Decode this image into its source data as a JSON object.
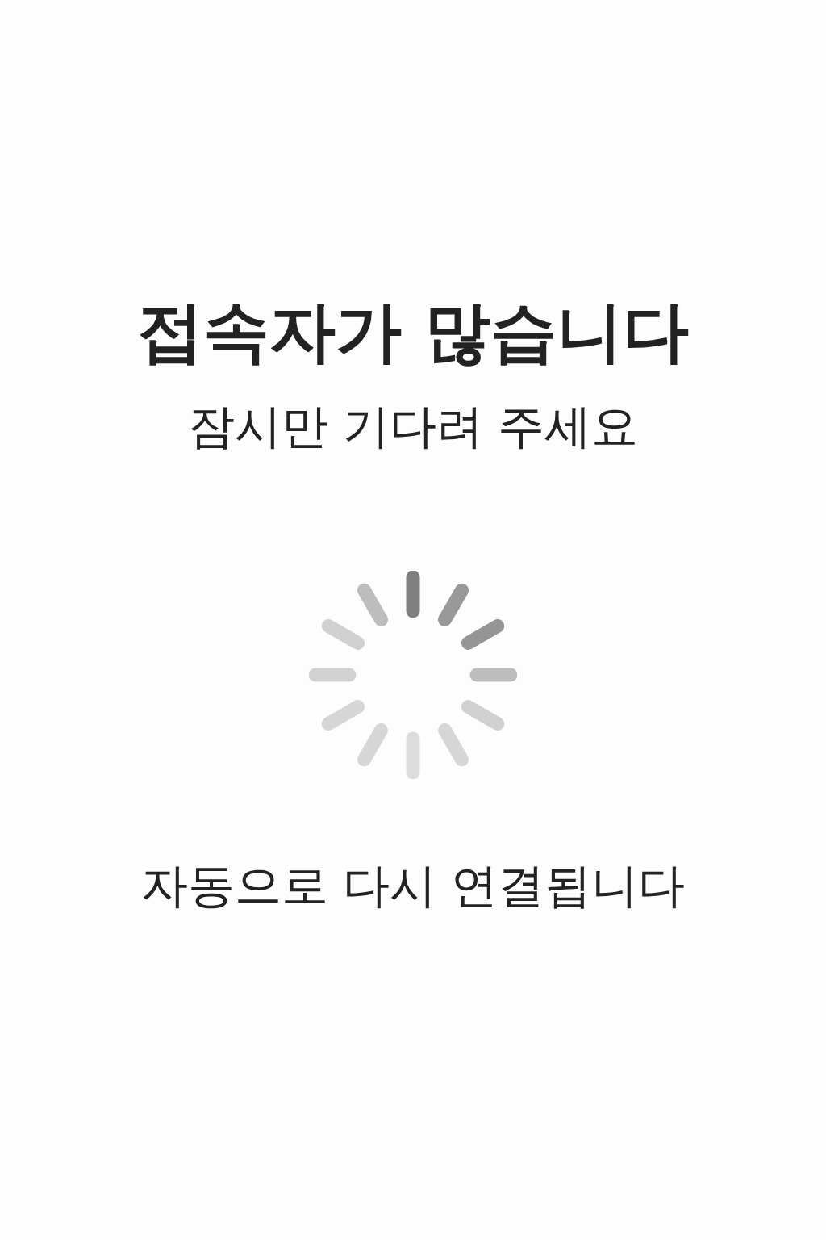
{
  "title": "접속자가 많습니다",
  "subtitle": "잠시만 기다려 주세요",
  "message": "자동으로 다시 연결됩니다"
}
